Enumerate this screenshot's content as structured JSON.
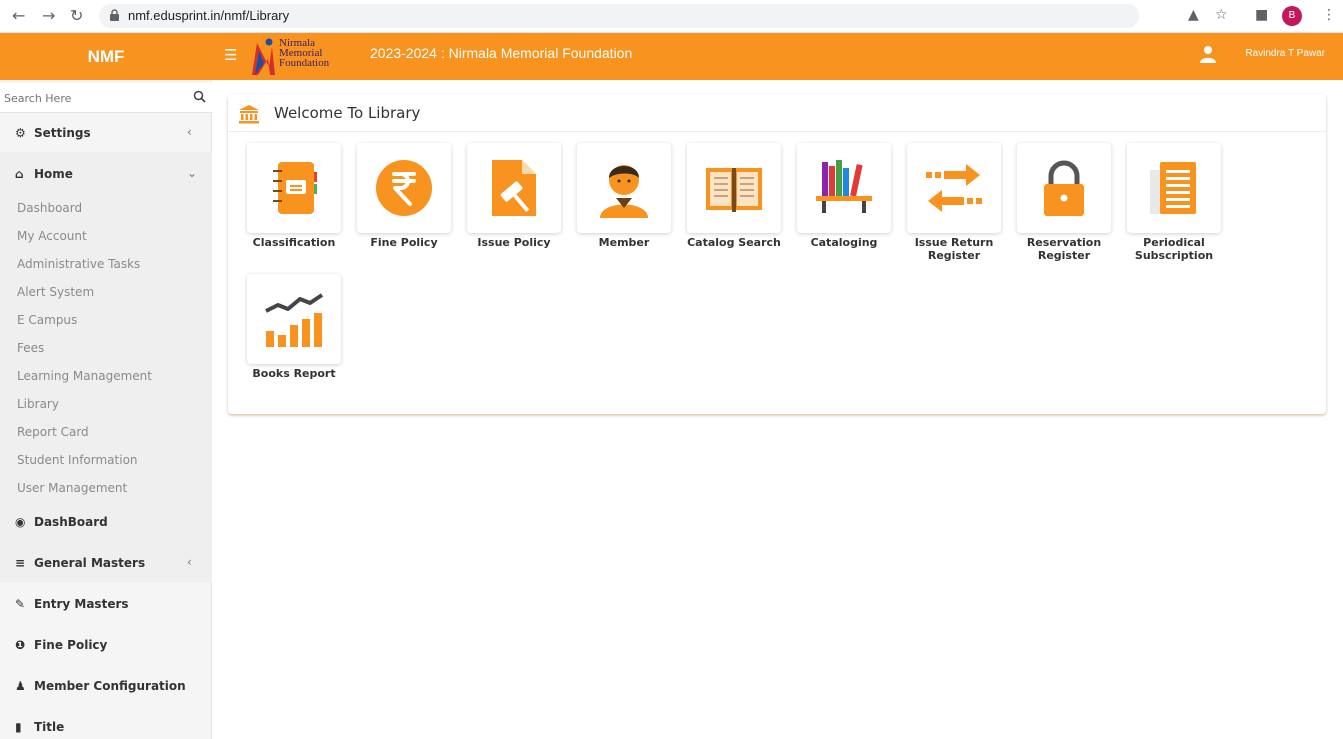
{
  "browser": {
    "url": "nmf.edusprint.in/nmf/Library",
    "profile_initial": "B"
  },
  "topbar": {
    "brand": "NMF",
    "logo_lines": [
      "Nirmala",
      "Memorial",
      "Foundation"
    ],
    "session": "2023-2024 : Nirmala Memorial Foundation",
    "user_name": "Ravindra T Pawar",
    "accent": "#f7931e"
  },
  "sidebar": {
    "search_placeholder": "Search Here",
    "settings": "Settings",
    "home": "Home",
    "home_items": [
      "Dashboard",
      "My Account",
      "Administrative Tasks",
      "Alert System",
      "E Campus",
      "Fees",
      "Learning Management",
      "Library",
      "Report Card",
      "Student Information",
      "User Management"
    ],
    "dashboard": "DashBoard",
    "general_masters": "General Masters",
    "entry_masters": "Entry Masters",
    "fine_policy": "Fine Policy",
    "member_configuration": "Member Configuration",
    "title": "Title"
  },
  "main": {
    "heading": "Welcome To Library",
    "tiles": [
      {
        "label": "Classification",
        "icon": "notebook-icon"
      },
      {
        "label": "Fine Policy",
        "icon": "rupee-icon"
      },
      {
        "label": "Issue Policy",
        "icon": "gavel-document-icon"
      },
      {
        "label": "Member",
        "icon": "person-icon"
      },
      {
        "label": "Catalog Search",
        "icon": "open-book-icon"
      },
      {
        "label": "Cataloging",
        "icon": "bookshelf-icon"
      },
      {
        "label": "Issue Return Register",
        "icon": "exchange-arrows-icon"
      },
      {
        "label": "Reservation Register",
        "icon": "padlock-icon"
      },
      {
        "label": "Periodical Subscription",
        "icon": "newspaper-icon"
      },
      {
        "label": "Books Report",
        "icon": "bar-chart-icon"
      }
    ]
  }
}
